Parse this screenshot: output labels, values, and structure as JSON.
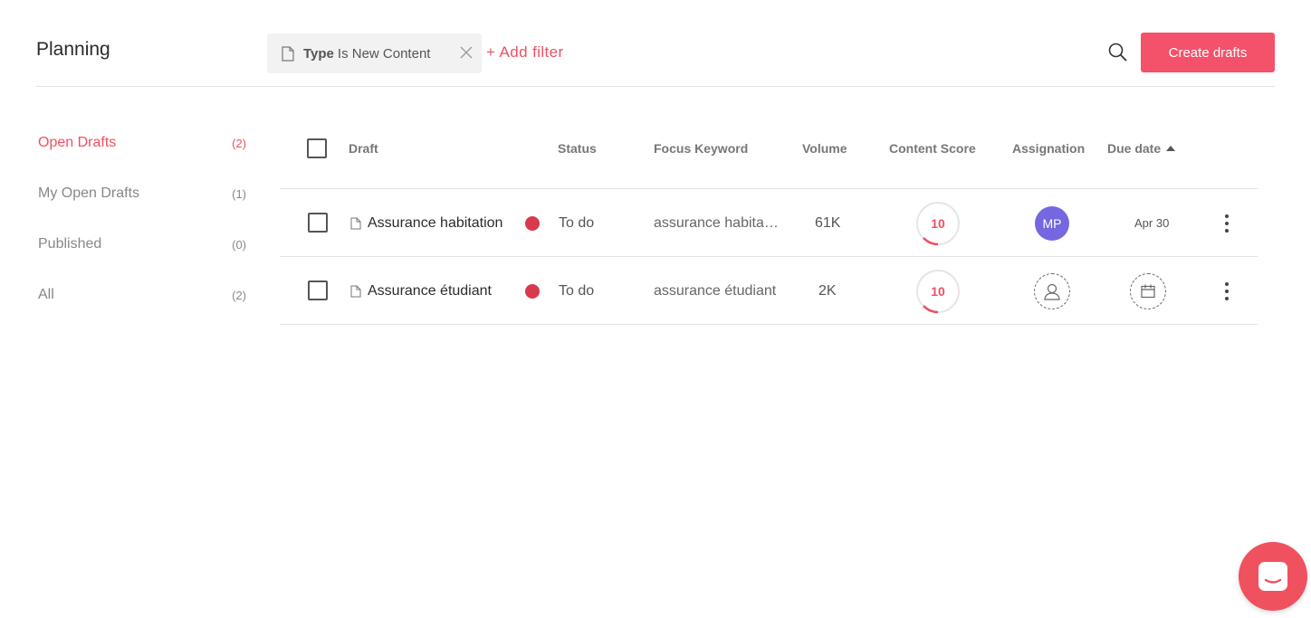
{
  "header": {
    "title": "Planning",
    "filter": {
      "field": "Type",
      "operator_value": "Is New Content"
    },
    "add_filter_label": "+ Add filter",
    "create_label": "Create drafts"
  },
  "sidebar": {
    "items": [
      {
        "label": "Open Drafts",
        "count": "(2)",
        "active": true
      },
      {
        "label": "My Open Drafts",
        "count": "(1)"
      },
      {
        "label": "Published",
        "count": "(0)"
      },
      {
        "label": "All",
        "count": "(2)"
      }
    ]
  },
  "table": {
    "columns": {
      "draft": "Draft",
      "status": "Status",
      "keyword": "Focus Keyword",
      "volume": "Volume",
      "score": "Content Score",
      "assignation": "Assignation",
      "due": "Due date"
    },
    "rows": [
      {
        "name": "Assurance habitation",
        "status": "To do",
        "keyword": "assurance habitation",
        "volume": "61K",
        "score": "10",
        "assignee_initials": "MP",
        "due": "Apr 30"
      },
      {
        "name": "Assurance étudiant",
        "status": "To do",
        "keyword": "assurance étudiant",
        "volume": "2K",
        "score": "10",
        "assignee_initials": null,
        "due": null
      }
    ]
  },
  "colors": {
    "accent": "#f4516a",
    "status_todo": "#d63a4c",
    "avatar": "#7468e0"
  },
  "icons": [
    "document-icon",
    "close-icon",
    "search-icon",
    "sort-asc-icon",
    "user-placeholder-icon",
    "calendar-icon",
    "more-vertical-icon",
    "chat-icon"
  ]
}
